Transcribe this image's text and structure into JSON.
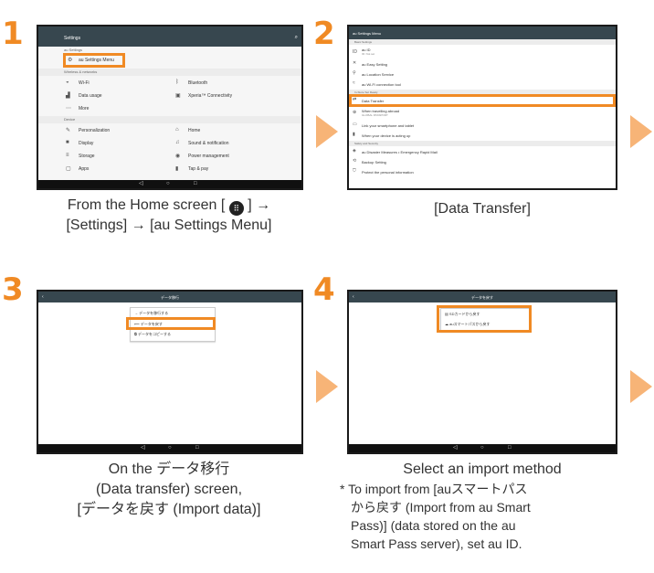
{
  "steps": [
    {
      "number": "1"
    },
    {
      "number": "2"
    },
    {
      "number": "3"
    },
    {
      "number": "4"
    }
  ],
  "step1": {
    "screen_title": "Settings",
    "au_settings_header": "au Settings",
    "au_settings_menu": "au Settings Menu",
    "wireless_header": "Wireless & networks",
    "wifi": "Wi-Fi",
    "bluetooth": "Bluetooth",
    "data_usage": "Data usage",
    "xperia_connectivity": "Xperia™ Connectivity",
    "more": "More",
    "device_header": "Device",
    "personalization": "Personalization",
    "home": "Home",
    "display": "Display",
    "sound": "Sound & notification",
    "storage": "Storage",
    "power": "Power management",
    "apps": "Apps",
    "tap_pay": "Tap & pay",
    "caption_line1_pre": "From the Home screen [",
    "caption_line1_post": "] →",
    "caption_line2": "[Settings] → [au Settings Menu]"
  },
  "step2": {
    "screen_title": "au Settings Menu",
    "basic_header": "Basic Settings",
    "au_id": "au ID",
    "au_id_sub": "ID: Not set",
    "easy_setting": "au Easy Setting",
    "location": "au Location Service",
    "wifi_tool": "au Wi-Fi connection tool",
    "bring_header": "In-Store Set Ready",
    "data_transfer": "Data Transfer",
    "abroad": "When travelling abroad",
    "abroad_sub": "GLOBAL PASSPORT",
    "link_phone": "Link your smartphone and tablet",
    "setting_up": "When your device is acting up",
    "safety_header": "Safety and Security",
    "disaster": "au Disaster Measures • Emergency Rapid Mail",
    "backup": "Backup Setting",
    "protect": "Protect the personal information",
    "caption": "[Data Transfer]"
  },
  "step3": {
    "screen_title": "データ移行",
    "opt1": "データを移行する",
    "opt2": "データを戻す",
    "opt3": "データをコピーする",
    "caption_line1": "On the データ移行",
    "caption_line2": "(Data transfer) screen,",
    "caption_line3": "[データを戻す (Import data)]"
  },
  "step4": {
    "screen_title": "データを戻す",
    "opt1": "SDカードから戻す",
    "opt2": "auスマートパスから戻す",
    "caption_line1": "Select an import method",
    "note_line1": "* To import from [auスマートパス",
    "note_line2": "から戻す (Import from au Smart",
    "note_line3": "Pass)] (data stored on the au",
    "note_line4": "Smart Pass server), set au ID."
  },
  "navbar": {
    "back": "◁",
    "home": "○",
    "recent": "□"
  },
  "colors": {
    "accent": "#f08a24",
    "arrow": "#f7b477",
    "status_bar": "#37474f"
  }
}
